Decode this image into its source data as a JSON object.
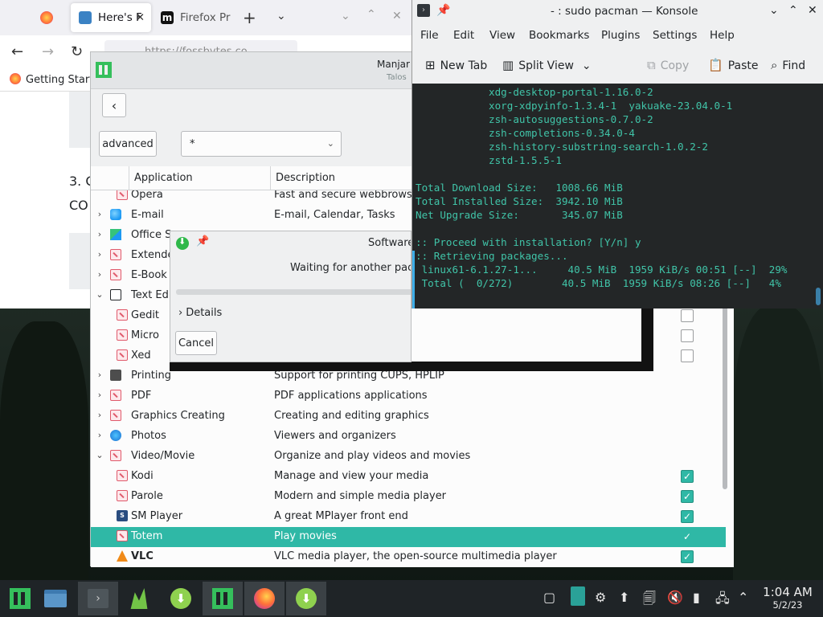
{
  "firefox": {
    "tabs": [
      {
        "label": "",
        "favicon_color": "#ff7139"
      },
      {
        "label": "Here's F",
        "favicon_color": "#3b82c4"
      },
      {
        "label": "Firefox Pr",
        "favicon_color": "#111111"
      }
    ],
    "new_tab_icon": "plus-icon",
    "url": "https://fossbytes.co",
    "bookmark": "Getting Start",
    "page_text_1": "3. C",
    "page_text_2": "CO"
  },
  "msw": {
    "title": "Manjar",
    "subtitle": "Talos",
    "advanced_label": "advanced",
    "filter_value": "*",
    "columns": [
      "Application",
      "Description"
    ],
    "rows": [
      {
        "expander": "",
        "indent": 1,
        "icon": "pkg",
        "name": "Opera",
        "desc": "Fast and secure webbrowser",
        "check": null,
        "bold": false,
        "selected": false
      },
      {
        "expander": "›",
        "indent": 0,
        "icon": "mail",
        "name": "E-mail",
        "desc": "E-mail, Calendar, Tasks",
        "check": null,
        "bold": false,
        "selected": false
      },
      {
        "expander": "›",
        "indent": 0,
        "icon": "office",
        "name": "Office S",
        "desc": "",
        "check": null,
        "bold": false,
        "selected": false
      },
      {
        "expander": "›",
        "indent": 0,
        "icon": "pkg",
        "name": "Extende",
        "desc": "",
        "check": null,
        "bold": false,
        "selected": false
      },
      {
        "expander": "›",
        "indent": 0,
        "icon": "pkg",
        "name": "E-Book",
        "desc": "",
        "check": null,
        "bold": false,
        "selected": false
      },
      {
        "expander": "⌄",
        "indent": 0,
        "icon": "edit",
        "name": "Text Edi",
        "desc": "",
        "check": null,
        "bold": false,
        "selected": false
      },
      {
        "expander": "",
        "indent": 1,
        "icon": "pkg",
        "name": "Gedit",
        "desc": "",
        "check": false,
        "bold": false,
        "selected": false
      },
      {
        "expander": "",
        "indent": 1,
        "icon": "pkg",
        "name": "Micro",
        "desc": "",
        "check": false,
        "bold": false,
        "selected": false
      },
      {
        "expander": "",
        "indent": 1,
        "icon": "pkg",
        "name": "Xed",
        "desc": "",
        "check": false,
        "bold": false,
        "selected": false
      },
      {
        "expander": "›",
        "indent": 0,
        "icon": "print",
        "name": "Printing",
        "desc": "Support for printing CUPS, HPLIP",
        "check": null,
        "bold": false,
        "selected": false
      },
      {
        "expander": "›",
        "indent": 0,
        "icon": "pkg",
        "name": "PDF",
        "desc": "PDF applications applications",
        "check": null,
        "bold": false,
        "selected": false
      },
      {
        "expander": "›",
        "indent": 0,
        "icon": "pkg",
        "name": "Graphics Creating",
        "desc": "Creating and editing graphics",
        "check": null,
        "bold": false,
        "selected": false
      },
      {
        "expander": "›",
        "indent": 0,
        "icon": "photo",
        "name": "Photos",
        "desc": "Viewers and organizers",
        "check": null,
        "bold": false,
        "selected": false
      },
      {
        "expander": "⌄",
        "indent": 0,
        "icon": "pkg",
        "name": "Video/Movie",
        "desc": "Organize and play videos and movies",
        "check": null,
        "bold": false,
        "selected": false
      },
      {
        "expander": "",
        "indent": 1,
        "icon": "pkg",
        "name": "Kodi",
        "desc": "Manage and view your media",
        "check": true,
        "bold": false,
        "selected": false
      },
      {
        "expander": "",
        "indent": 1,
        "icon": "pkg",
        "name": "Parole",
        "desc": "Modern and simple media player",
        "check": true,
        "bold": false,
        "selected": false
      },
      {
        "expander": "",
        "indent": 1,
        "icon": "sm",
        "name": "SM Player",
        "desc": "A great MPlayer front end",
        "check": true,
        "bold": false,
        "selected": false
      },
      {
        "expander": "",
        "indent": 1,
        "icon": "pkg",
        "name": "Totem",
        "desc": "Play movies",
        "check": true,
        "bold": false,
        "selected": true
      },
      {
        "expander": "",
        "indent": 1,
        "icon": "vlc",
        "name": "VLC",
        "desc": "VLC media player, the open-source multimedia player",
        "check": true,
        "bold": true,
        "selected": false
      }
    ]
  },
  "dialog": {
    "title": "Software",
    "message": "Waiting for another pack",
    "details_label": "Details",
    "cancel_label": "Cancel"
  },
  "konsole": {
    "title": "- : sudo pacman — Konsole",
    "menu": [
      "File",
      "Edit",
      "View",
      "Bookmarks",
      "Plugins",
      "Settings",
      "Help"
    ],
    "toolbar": {
      "new_tab": "New Tab",
      "split_view": "Split View",
      "copy": "Copy",
      "paste": "Paste",
      "find": "Find"
    },
    "terminal_lines": [
      "            xdg-desktop-portal-1.16.0-2",
      "            xorg-xdpyinfo-1.3.4-1  yakuake-23.04.0-1",
      "            zsh-autosuggestions-0.7.0-2",
      "            zsh-completions-0.34.0-4",
      "            zsh-history-substring-search-1.0.2-2",
      "            zstd-1.5.5-1",
      "",
      "Total Download Size:   1008.66 MiB",
      "Total Installed Size:  3942.10 MiB",
      "Net Upgrade Size:       345.07 MiB",
      "",
      ":: Proceed with installation? [Y/n] y",
      ":: Retrieving packages...",
      " linux61-6.1.27-1...     40.5 MiB  1959 KiB/s 00:51 [--]  29%",
      " Total (  0/272)        40.5 MiB  1959 KiB/s 08:26 [--]   4%"
    ]
  },
  "taskbar": {
    "clock_time": "1:04 AM",
    "clock_date": "5/2/23"
  }
}
